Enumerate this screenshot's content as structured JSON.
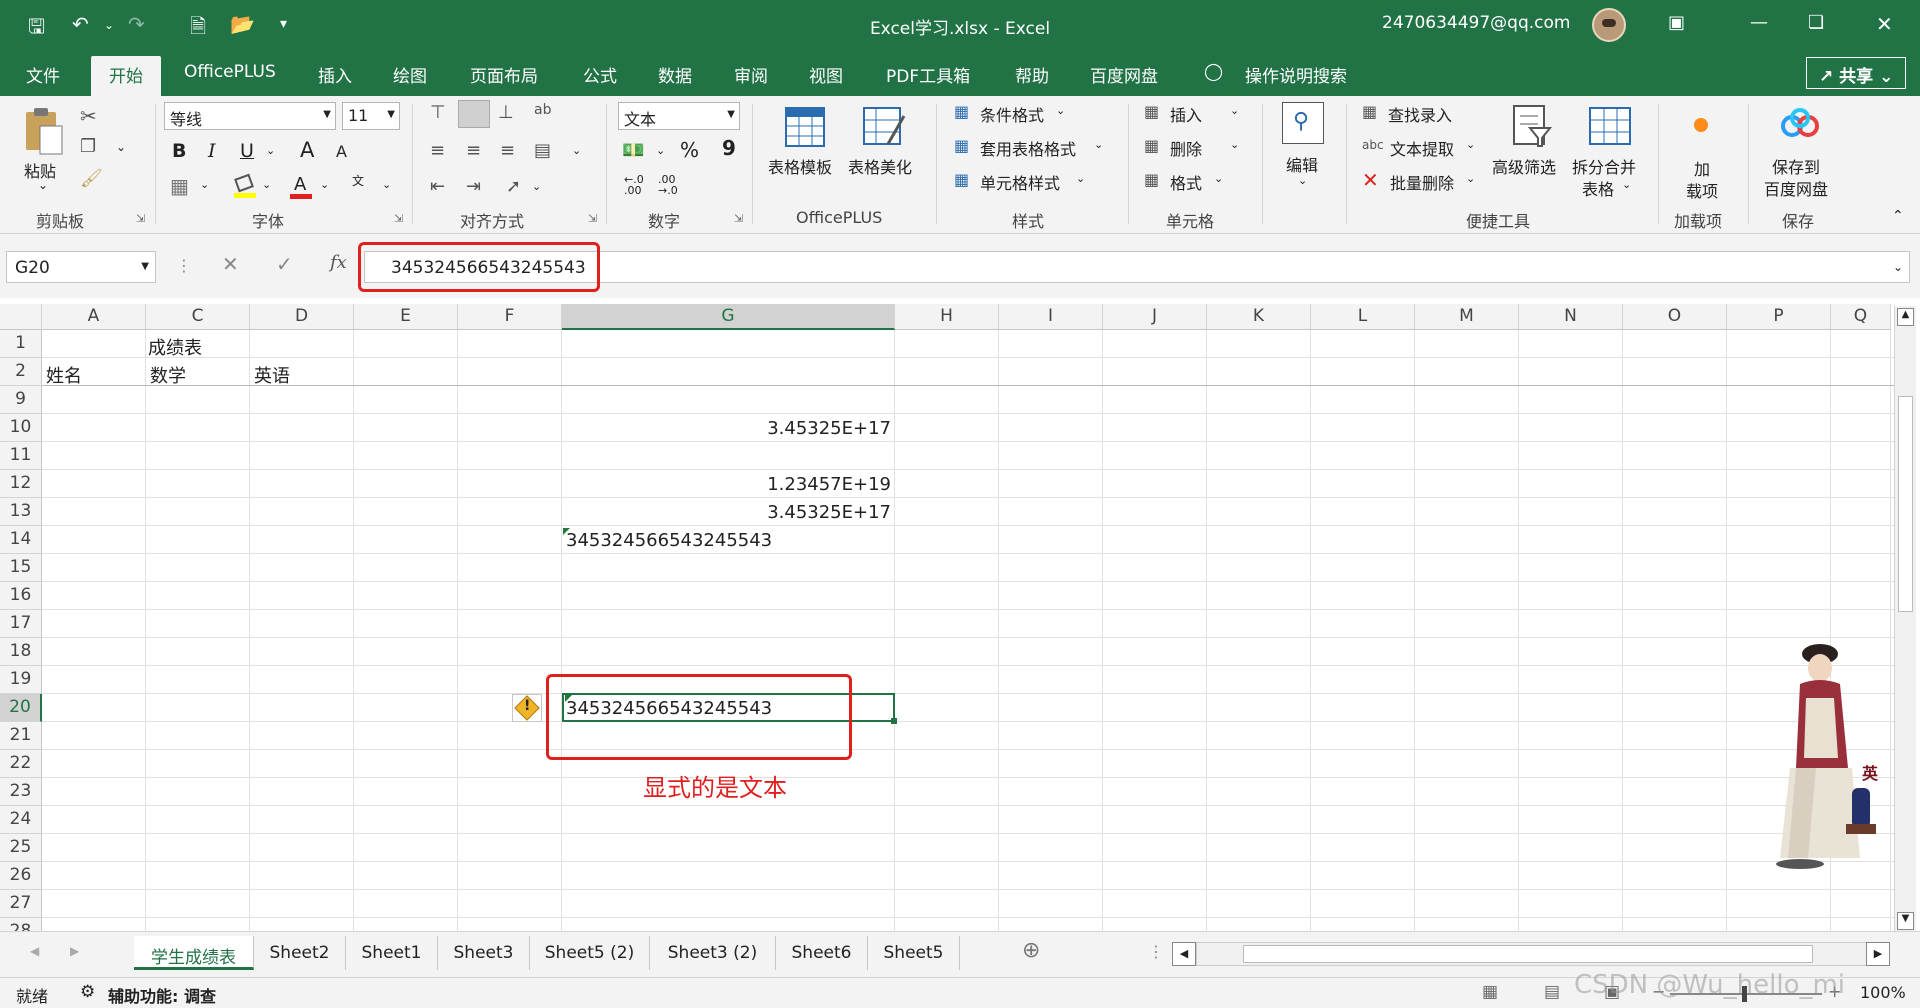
{
  "window": {
    "title": "Excel学习.xlsx  -  Excel",
    "account": "2470634497@qq.com"
  },
  "tabs": [
    "文件",
    "开始",
    "OfficePLUS",
    "插入",
    "绘图",
    "页面布局",
    "公式",
    "数据",
    "审阅",
    "视图",
    "PDF工具箱",
    "帮助",
    "百度网盘"
  ],
  "tell_me": "操作说明搜索",
  "share": "共享",
  "ribbon": {
    "clipboard": {
      "paste": "粘贴",
      "label": "剪贴板"
    },
    "font": {
      "name": "等线",
      "size": "11",
      "label": "字体",
      "bold": "B",
      "italic": "I",
      "underline": "U",
      "grow": "A",
      "shrink": "A"
    },
    "alignment": {
      "label": "对齐方式"
    },
    "number": {
      "format": "文本",
      "label": "数字",
      "percent": "%",
      "comma": "9"
    },
    "officeplus": {
      "template": "表格模板",
      "beautify": "表格美化",
      "label": "OfficePLUS"
    },
    "styles": {
      "conditional": "条件格式",
      "table_format": "套用表格格式",
      "cell_style": "单元格样式",
      "label": "样式"
    },
    "cells": {
      "insert": "插入",
      "delete": "删除",
      "format": "格式",
      "label": "单元格"
    },
    "edit": {
      "label": "编辑"
    },
    "tools": {
      "find": "查找录入",
      "extract": "文本提取",
      "batch_delete": "批量删除",
      "filter": "高级筛选",
      "split_merge_1": "拆分合并",
      "split_merge_2": "表格",
      "label": "便捷工具"
    },
    "addins": {
      "top": "加",
      "bottom": "载项",
      "label": "加载项"
    },
    "save": {
      "top": "保存到",
      "bottom": "百度网盘",
      "label": "保存"
    }
  },
  "formula_bar": {
    "name_box": "G20",
    "value": "345324566543245543",
    "fx": "fx"
  },
  "columns": [
    "A",
    "C",
    "D",
    "E",
    "F",
    "G",
    "H",
    "I",
    "J",
    "K",
    "L",
    "M",
    "N",
    "O",
    "P",
    "Q"
  ],
  "rows": [
    "1",
    "2",
    "9",
    "10",
    "11",
    "12",
    "13",
    "14",
    "15",
    "16",
    "17",
    "18",
    "19",
    "20",
    "21",
    "22",
    "23",
    "24",
    "25",
    "26",
    "27",
    "28"
  ],
  "cells": {
    "c1": "成绩表",
    "a2": "姓名",
    "c2": "数学",
    "d2": "英语",
    "g10": "3.45325E+17",
    "g12": "1.23457E+19",
    "g13": "3.45325E+17",
    "g14": "345324566543245543",
    "g20": "345324566543245543"
  },
  "annotation": "显式的是文本",
  "sheets": [
    "学生成绩表",
    "Sheet2",
    "Sheet1",
    "Sheet3",
    "Sheet5 (2)",
    "Sheet3 (2)",
    "Sheet6",
    "Sheet5"
  ],
  "status": {
    "ready": "就绪",
    "accessibility": "辅助功能: 调查",
    "zoom": "100%",
    "watermark": "CSDN @Wu_hello_mi",
    "lady_char": "英"
  }
}
